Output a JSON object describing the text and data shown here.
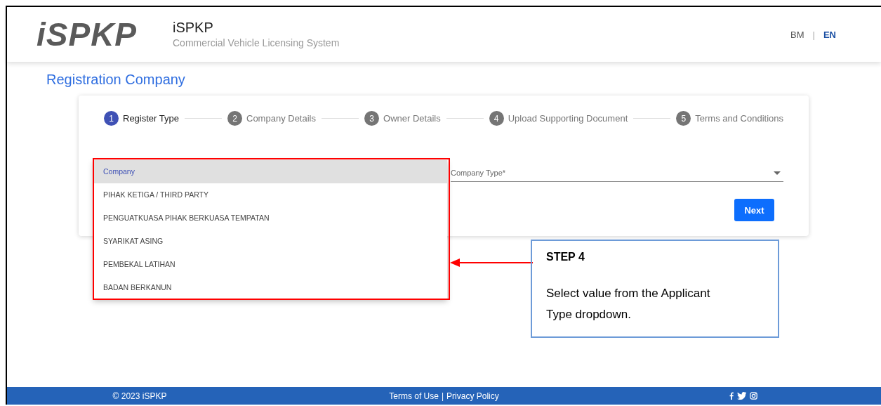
{
  "header": {
    "logo_text": "iSPKP",
    "title": "iSPKP",
    "subtitle": "Commercial Vehicle Licensing System",
    "languages": [
      {
        "label": "BM",
        "selected": false
      },
      {
        "label": "EN",
        "selected": true
      }
    ],
    "language_separator": "|"
  },
  "page_title": "Registration Company",
  "stepper": [
    {
      "number": "1",
      "label": "Register Type",
      "selected": true
    },
    {
      "number": "2",
      "label": "Company Details",
      "selected": false
    },
    {
      "number": "3",
      "label": "Owner Details",
      "selected": false
    },
    {
      "number": "4",
      "label": "Upload Supporting Document",
      "selected": false
    },
    {
      "number": "5",
      "label": "Terms and Conditions",
      "selected": false
    }
  ],
  "form": {
    "dropdown_options": [
      {
        "label": "Company",
        "selected": true
      },
      {
        "label": "PIHAK KETIGA / THIRD PARTY",
        "selected": false
      },
      {
        "label": "PENGUATKUASA PIHAK BERKUASA TEMPATAN",
        "selected": false
      },
      {
        "label": "SYARIKAT ASING",
        "selected": false
      },
      {
        "label": "PEMBEKAL LATIHAN",
        "selected": false
      },
      {
        "label": "BADAN BERKANUN",
        "selected": false
      }
    ],
    "company_type": {
      "placeholder": "Company Type*"
    },
    "next_button": "Next"
  },
  "annotation": {
    "title": "STEP 4",
    "text": "Select value from the Applicant Type dropdown."
  },
  "footer": {
    "copyright": "© 2023 iSPKP",
    "links": [
      "Terms of Use",
      "Privacy Policy"
    ],
    "separator": "|"
  }
}
